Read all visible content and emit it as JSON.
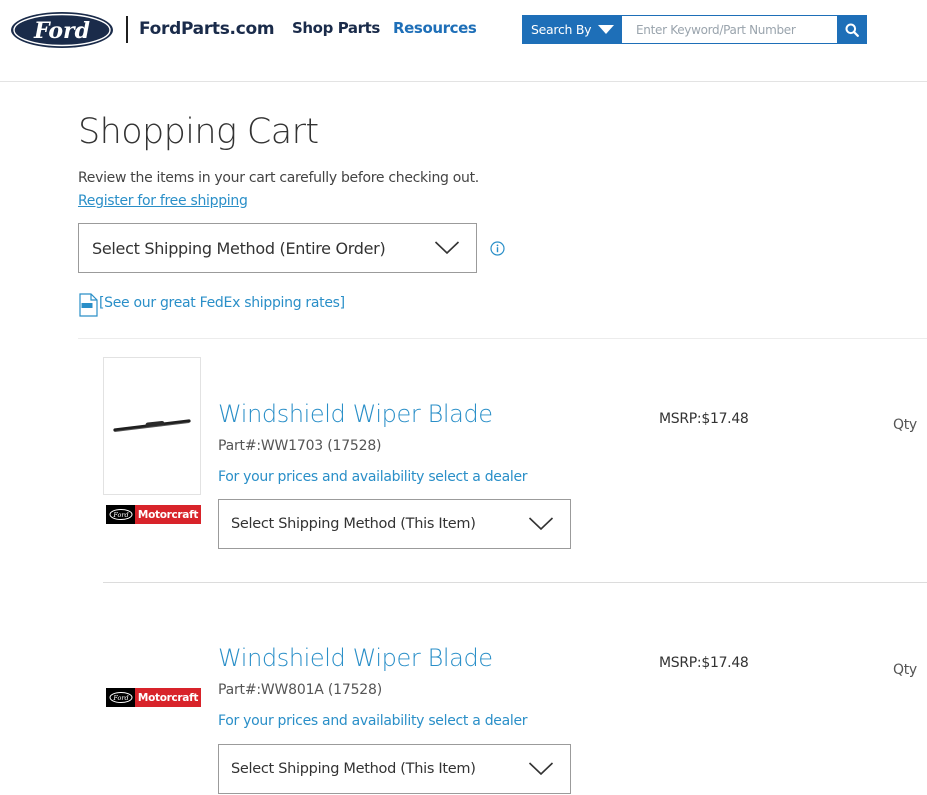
{
  "header": {
    "logo_text": "Ford",
    "brand": "FordParts.com",
    "nav": {
      "shop_parts": "Shop Parts",
      "resources": "Resources"
    },
    "search": {
      "by_label": "Search By",
      "placeholder": "Enter Keyword/Part Number",
      "value": ""
    }
  },
  "cart": {
    "title": "Shopping Cart",
    "intro": "Review the items in your cart carefully before checking out.",
    "register_link": "Register for free shipping",
    "shipping_entire": "Select Shipping Method (Entire Order)",
    "fedex_link": "[See our great FedEx shipping rates]"
  },
  "items": [
    {
      "title": "Windshield Wiper Blade",
      "part": "Part#:WW1703 (17528)",
      "dealer": "For your prices and availability select a dealer",
      "shipping": "Select Shipping Method (This Item)",
      "msrp": "MSRP:$17.48",
      "qty_label": "Qty",
      "brand_logo": "Motorcraft",
      "has_image": true
    },
    {
      "title": "Windshield Wiper Blade",
      "part": "Part#:WW801A (17528)",
      "dealer": "For your prices and availability select a dealer",
      "shipping": "Select Shipping Method (This Item)",
      "msrp": "MSRP:$17.48",
      "qty_label": "Qty",
      "brand_logo": "Motorcraft",
      "has_image": false
    }
  ],
  "colors": {
    "ford_blue": "#1a2b4a",
    "accent_blue": "#1e6fb8",
    "link_blue": "#2a8fc8",
    "motorcraft_red": "#d8232a"
  },
  "icons": {
    "search": "search-icon",
    "chevron": "chevron-down-icon",
    "info": "info-icon",
    "pdf": "pdf-document-icon"
  }
}
